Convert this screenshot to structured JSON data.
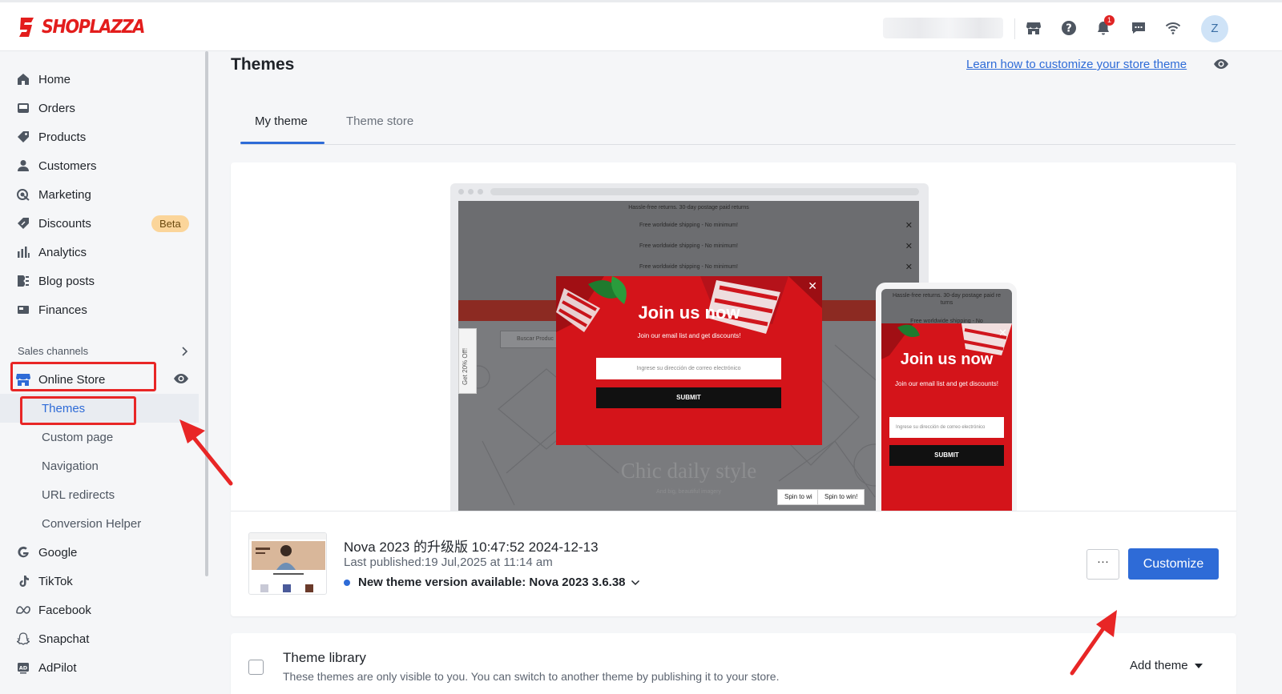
{
  "brand": {
    "name": "SHOPLAZZA",
    "color": "#e31d1c"
  },
  "header": {
    "icons": [
      "store-icon",
      "help-icon",
      "bell-icon",
      "chat-icon",
      "wifi-icon"
    ],
    "notification_count": "1",
    "avatar_initial": "Z"
  },
  "sidebar": {
    "items": [
      {
        "label": "Home",
        "icon": "home-icon"
      },
      {
        "label": "Orders",
        "icon": "orders-icon"
      },
      {
        "label": "Products",
        "icon": "tag-icon"
      },
      {
        "label": "Customers",
        "icon": "person-icon"
      },
      {
        "label": "Marketing",
        "icon": "marketing-icon"
      },
      {
        "label": "Discounts",
        "icon": "discount-icon",
        "badge": "Beta"
      },
      {
        "label": "Analytics",
        "icon": "analytics-icon"
      },
      {
        "label": "Blog posts",
        "icon": "blog-icon"
      },
      {
        "label": "Finances",
        "icon": "finances-icon"
      }
    ],
    "sales_channels_title": "Sales channels",
    "online_store": "Online Store",
    "online_store_sub": [
      "Themes",
      "Custom page",
      "Navigation",
      "URL redirects",
      "Conversion Helper"
    ],
    "channels": [
      {
        "label": "Google",
        "icon": "google-icon"
      },
      {
        "label": "TikTok",
        "icon": "tiktok-icon"
      },
      {
        "label": "Facebook",
        "icon": "meta-icon"
      },
      {
        "label": "Snapchat",
        "icon": "snapchat-icon"
      },
      {
        "label": "AdPilot",
        "icon": "adpilot-icon"
      }
    ]
  },
  "main": {
    "title": "Themes",
    "learn_link": "Learn how to customize your store theme",
    "tabs": [
      {
        "label": "My theme"
      },
      {
        "label": "Theme store"
      }
    ],
    "preview": {
      "announcement": "Hassle-free returns. 30-day postage paid returns",
      "shipping": "Free worldwide shipping - No minimum!",
      "popup_title": "Join us now",
      "popup_sub": "Join our email list and get discounts!",
      "popup_input": "Ingrese su dirección de correo electrónico",
      "popup_submit": "SUBMIT",
      "side_tab": "Get 20% Off!",
      "search": "Buscar Produc",
      "hero": "Chic daily style",
      "hero_sub": "And big, beautiful imagery",
      "spin_1": "Spin to wi",
      "spin_2": "Spin to win!",
      "phone_announcement": "Hassle-free returns. 30-day postage paid re turns",
      "phone_shipping": "Free worldwide shipping - No",
      "phone_popup_sub": "Join our email list and get discounts!",
      "phone_input": "Ingrese su dirección de correo electrónico"
    },
    "current_theme": {
      "name": "Nova 2023 的升级版 10:47:52 2024-12-13",
      "last_published": "Last published:19 Jul,2025 at 11:14 am",
      "new_version": "New theme version available: Nova 2023 3.6.38",
      "more_label": "···",
      "customize_label": "Customize"
    },
    "library": {
      "title": "Theme library",
      "description": "These themes are only visible to you. You can switch to another theme by publishing it to your store.",
      "add_label": "Add theme"
    }
  },
  "colors": {
    "accent": "#2e6bd7",
    "annotation_red": "#e82626"
  }
}
